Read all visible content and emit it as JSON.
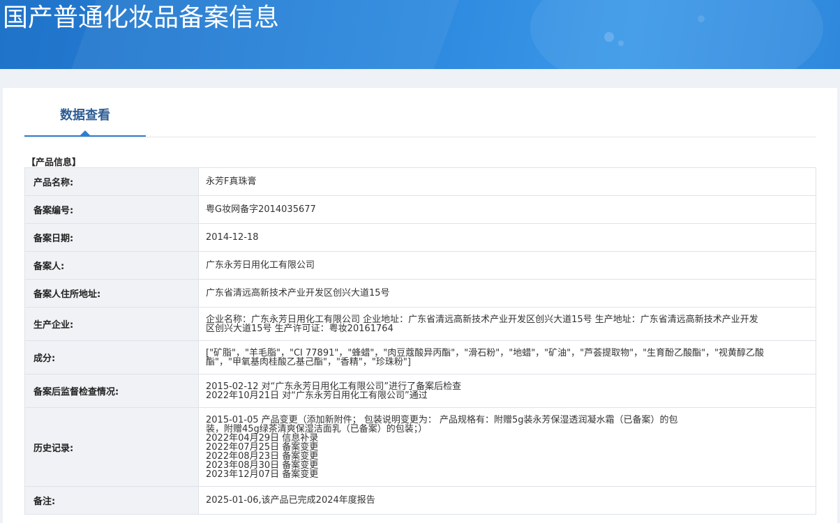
{
  "header": {
    "title": "国产普通化妆品备案信息"
  },
  "tabs": [
    {
      "label": "数据查看",
      "active": true
    }
  ],
  "section": {
    "title": "【产品信息】"
  },
  "fields": {
    "product_name": {
      "label": "产品名称:",
      "value": "永芳F真珠膏"
    },
    "record_no": {
      "label": "备案编号:",
      "value": "粤G妆网备字2014035677"
    },
    "record_date": {
      "label": "备案日期:",
      "value": "2014-12-18"
    },
    "registrant": {
      "label": "备案人:",
      "value": "广东永芳日用化工有限公司"
    },
    "address": {
      "label": "备案人住所地址:",
      "value": "广东省清远高新技术产业开发区创兴大道15号"
    },
    "manufacturer": {
      "label": "生产企业:",
      "lines": [
        "企业名称：广东永芳日用化工有限公司 企业地址：广东省清远高新技术产业开发区创兴大道15号 生产地址：广东省清远高新技术产业开发",
        "区创兴大道15号 生产许可证：粤妆20161764"
      ]
    },
    "ingredients": {
      "label": "成分:",
      "lines": [
        "[\"矿脂\"，\"羊毛脂\"，\"CI 77891\"，\"蜂蜡\"，\"肉豆蔻酸异丙酯\"，\"滑石粉\"，\"地蜡\"，\"矿油\"，\"芦荟提取物\"，\"生育酚乙酸酯\"，\"视黄醇乙酸",
        "酯\"，\"甲氧基肉桂酸乙基己酯\"，\"香精\"，\"珍珠粉\"]"
      ]
    },
    "inspection": {
      "label": "备案后监督检查情况:",
      "lines": [
        "2015-02-12 对“广东永芳日用化工有限公司”进行了备案后检查",
        "2022年10月21日 对“广东永芳日用化工有限公司”通过"
      ]
    },
    "history": {
      "label": "历史记录:",
      "lines": [
        "2015-01-05 产品变更（添加新附件； 包装说明变更为： 产品规格有：附赠5g装永芳保湿透润凝水霜（已备案）的包",
        "装，附赠45g绿茶清爽保湿洁面乳（已备案）的包装；）",
        "2022年04月29日 信息补录",
        "2022年07月25日 备案变更",
        "2022年08月23日 备案变更",
        "2023年08月30日 备案变更",
        "2023年12月07日 备案变更"
      ]
    },
    "remark": {
      "label": "备注:",
      "value": "2025-01-06,该产品已完成2024年度报告"
    }
  }
}
